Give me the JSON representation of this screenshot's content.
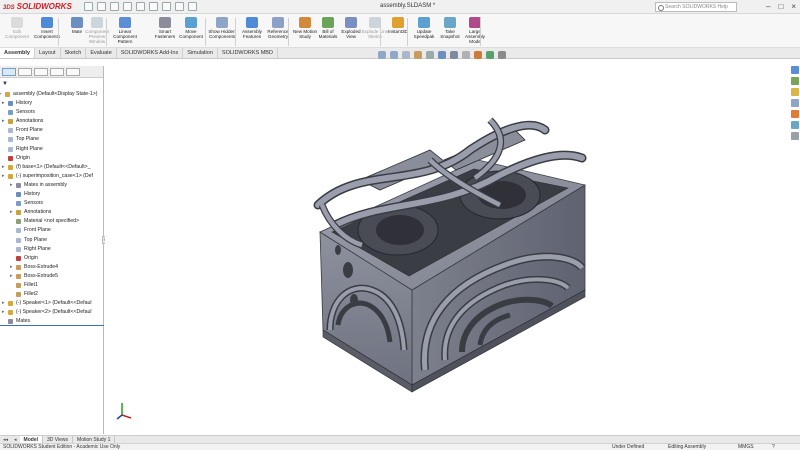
{
  "titlebar": {
    "logo": "SOLIDWORKS",
    "logo_prefix": "3DS",
    "title": "assembly.SLDASM *",
    "search_placeholder": "Search SOLIDWORKS Help"
  },
  "commands": [
    {
      "label": "Edit Component",
      "icon": "edit-component-icon",
      "enabled": false
    },
    {
      "label": "Insert Components",
      "icon": "insert-components-icon",
      "enabled": true
    },
    {
      "label": "Mate",
      "icon": "mate-icon",
      "enabled": true
    },
    {
      "label": "Component Preview Window",
      "icon": "preview-window-icon",
      "enabled": false
    },
    {
      "label": "Linear Component Pattern",
      "icon": "linear-pattern-icon",
      "enabled": true
    },
    {
      "label": "Smart Fasteners",
      "icon": "smart-fasteners-icon",
      "enabled": true
    },
    {
      "label": "Move Component",
      "icon": "move-component-icon",
      "enabled": true
    },
    {
      "label": "Show Hidden Components",
      "icon": "show-hidden-icon",
      "enabled": true
    },
    {
      "label": "Assembly Features",
      "icon": "assembly-features-icon",
      "enabled": true
    },
    {
      "label": "Reference Geometry",
      "icon": "reference-geometry-icon",
      "enabled": true
    },
    {
      "label": "New Motion Study",
      "icon": "motion-study-icon",
      "enabled": true
    },
    {
      "label": "Bill of Materials",
      "icon": "bill-of-materials-icon",
      "enabled": true
    },
    {
      "label": "Exploded View",
      "icon": "exploded-view-icon",
      "enabled": true
    },
    {
      "label": "Explode Line Sketch",
      "icon": "explode-line-icon",
      "enabled": false
    },
    {
      "label": "Instant3D",
      "icon": "instant3d-icon",
      "enabled": true
    },
    {
      "label": "Update Speedpak",
      "icon": "speedpak-icon",
      "enabled": true
    },
    {
      "label": "Take Snapshot",
      "icon": "snapshot-icon",
      "enabled": true
    },
    {
      "label": "Large Assembly Mode",
      "icon": "large-assembly-icon",
      "enabled": true
    }
  ],
  "tabs": [
    "Assembly",
    "Layout",
    "Sketch",
    "Evaluate",
    "SOLIDWORKS Add-Ins",
    "Simulation",
    "SOLIDWORKS MBD"
  ],
  "active_tab": "Assembly",
  "tree": [
    {
      "label": "assembly  (Default<Display State-1>)",
      "level": 0,
      "icon": "assembly-icon"
    },
    {
      "label": "History",
      "level": 1,
      "icon": "history-icon"
    },
    {
      "label": "Sensors",
      "level": 1,
      "icon": "sensors-icon"
    },
    {
      "label": "Annotations",
      "level": 1,
      "icon": "annotations-icon"
    },
    {
      "label": "Front Plane",
      "level": 1,
      "icon": "plane-icon"
    },
    {
      "label": "Top Plane",
      "level": 1,
      "icon": "plane-icon"
    },
    {
      "label": "Right Plane",
      "level": 1,
      "icon": "plane-icon"
    },
    {
      "label": "Origin",
      "level": 1,
      "icon": "origin-icon"
    },
    {
      "label": "(f) base<1> (Default<<Default>_",
      "level": 1,
      "icon": "part-icon"
    },
    {
      "label": "(-) superimposition_case<1> (Def",
      "level": 1,
      "icon": "part-icon"
    },
    {
      "label": "Mates in assembly",
      "level": 2,
      "icon": "mates-icon"
    },
    {
      "label": "History",
      "level": 2,
      "icon": "history-icon"
    },
    {
      "label": "Sensors",
      "level": 2,
      "icon": "sensors-icon"
    },
    {
      "label": "Annotations",
      "level": 2,
      "icon": "annotations-icon"
    },
    {
      "label": "Material <not specified>",
      "level": 2,
      "icon": "material-icon"
    },
    {
      "label": "Front Plane",
      "level": 2,
      "icon": "plane-icon"
    },
    {
      "label": "Top Plane",
      "level": 2,
      "icon": "plane-icon"
    },
    {
      "label": "Right Plane",
      "level": 2,
      "icon": "plane-icon"
    },
    {
      "label": "Origin",
      "level": 2,
      "icon": "origin-icon"
    },
    {
      "label": "Boss-Extrude4",
      "level": 2,
      "icon": "extrude-icon"
    },
    {
      "label": "Boss-Extrude5",
      "level": 2,
      "icon": "extrude-icon"
    },
    {
      "label": "Fillet1",
      "level": 2,
      "icon": "fillet-icon"
    },
    {
      "label": "Fillet2",
      "level": 2,
      "icon": "fillet-icon"
    },
    {
      "label": "(-) Speaker<1> (Default<<Defaul",
      "level": 1,
      "icon": "part-icon"
    },
    {
      "label": "(-) Speaker<2> (Default<<Defaul",
      "level": 1,
      "icon": "part-icon"
    },
    {
      "label": "Mates",
      "level": 1,
      "icon": "mates-icon"
    }
  ],
  "bottom_tabs": [
    "Model",
    "3D Views",
    "Motion Study 1"
  ],
  "active_bottom_tab": "Model",
  "status": {
    "left": "SOLIDWORKS Student Edition - Academic Use Only",
    "state": "Under Defined",
    "mode": "Editing Assembly",
    "units": "MMGS",
    "help": "?"
  },
  "colors": {
    "model_body": "#8a8d9a",
    "model_dark": "#3a3c44",
    "accent_blue": "#3a6fc9",
    "logo_red": "#d4202a"
  }
}
